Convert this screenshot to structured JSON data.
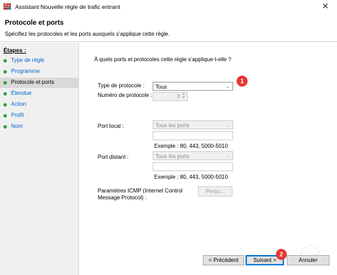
{
  "window": {
    "title": "Assistant Nouvelle règle de trafic entrant",
    "close_glyph": "✕"
  },
  "header": {
    "title": "Protocole et ports",
    "subtitle": "Spécifiez les protocoles et les ports auxquels s’applique cette règle."
  },
  "steps": {
    "heading": "Étapes :",
    "items": [
      {
        "label": "Type de règle",
        "active": false
      },
      {
        "label": "Programme",
        "active": false
      },
      {
        "label": "Protocole et ports",
        "active": true
      },
      {
        "label": "Étendue",
        "active": false
      },
      {
        "label": "Action",
        "active": false
      },
      {
        "label": "Profil",
        "active": false
      },
      {
        "label": "Nom",
        "active": false
      }
    ],
    "dot_color": "#2fa033"
  },
  "main": {
    "question": "À quels ports et protocoles cette règle s’applique-t-elle ?",
    "protocol_type_label": "Type de protocole :",
    "protocol_type_value": "Tous",
    "protocol_number_label": "Numéro de protocole :",
    "protocol_number_value": "0",
    "local_port_label": "Port local :",
    "local_port_value": "Tous les ports",
    "local_port_example": "Exemple : 80, 443, 5000-5010",
    "remote_port_label": "Port distant :",
    "remote_port_value": "Tous les ports",
    "remote_port_example": "Exemple : 80, 443, 5000-5010",
    "icmp_label": "Paramètres ICMP (Internet Control Message Protocol) :",
    "icmp_button": "Perso..."
  },
  "footer": {
    "previous": "< Précédent",
    "next": "Suivant >",
    "cancel": "Annuler"
  },
  "annotations": {
    "badge1": "1",
    "badge2": "2",
    "badge_color": "#e53935"
  }
}
